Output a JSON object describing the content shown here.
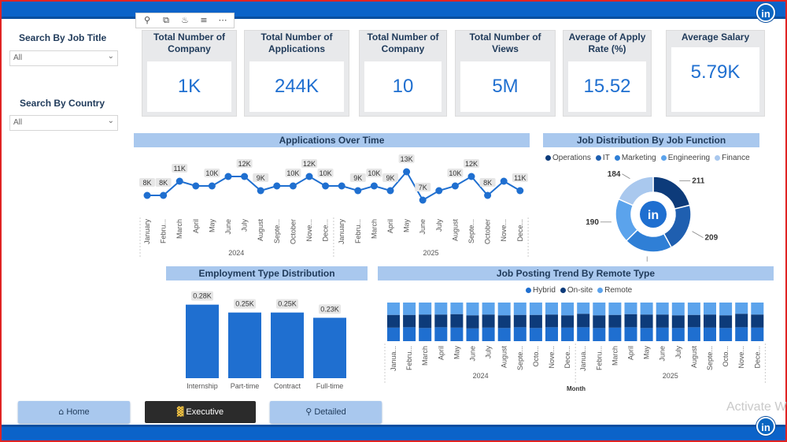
{
  "toolbar": {
    "icons": [
      "pin-icon",
      "copy-icon",
      "bell-icon",
      "filter-icon",
      "more-icon"
    ]
  },
  "brand": {
    "logo_text": "in"
  },
  "slicers": {
    "job_title": {
      "label": "Search By Job Title",
      "value": "All"
    },
    "country": {
      "label": "Search By Country",
      "value": "All"
    }
  },
  "kpis": [
    {
      "title": "Total Number of Company",
      "value": "1K"
    },
    {
      "title": "Total Number of Applications",
      "value": "244K"
    },
    {
      "title": "Total Number of Company",
      "value": "10"
    },
    {
      "title": "Total Number of Views",
      "value": "5M"
    },
    {
      "title": "Average of Apply Rate (%)",
      "value": "15.52"
    },
    {
      "title": "Average Salary",
      "value": "5.79K"
    }
  ],
  "sections": {
    "applications": "Applications Over Time",
    "job_distribution": "Job Distribution By Job Function",
    "employment": "Employment Type Distribution",
    "remote": "Job Posting Trend By Remote Type"
  },
  "nav": {
    "home": "Home",
    "executive": "Executive",
    "detailed": "Detailed"
  },
  "watermark": "Activate W",
  "colors": {
    "primary": "#0b63c9",
    "dark_navy": "#0d3b7a",
    "mid_blue": "#1f6fd0",
    "light_blue": "#5ba3ec",
    "pale_blue": "#a9c8ee",
    "accent_frame": "#e02424"
  },
  "chart_data": [
    {
      "type": "line",
      "title": "Applications Over Time",
      "x": [
        "January",
        "Febru...",
        "March",
        "April",
        "May",
        "June",
        "July",
        "August",
        "Septe...",
        "October",
        "Nove...",
        "Dece...",
        "January",
        "Febru...",
        "March",
        "April",
        "May",
        "June",
        "July",
        "August",
        "Septe...",
        "October",
        "Nove...",
        "Dece..."
      ],
      "years": [
        "2024",
        "2025"
      ],
      "series": [
        {
          "values": [
            8,
            8,
            11,
            10,
            10,
            12,
            12,
            9,
            10,
            10,
            12,
            10,
            10,
            9,
            10,
            9,
            13,
            7,
            9,
            10,
            12,
            8,
            11,
            9
          ]
        }
      ],
      "data_labels": [
        "8K",
        "8K",
        "11K",
        "",
        "10K",
        "",
        "12K",
        "9K",
        "",
        "10K",
        "12K",
        "10K",
        "",
        "9K",
        "10K",
        "9K",
        "13K",
        "7K",
        "",
        "10K",
        "12K",
        "8K",
        "",
        "11K"
      ],
      "ylim": [
        5,
        15
      ]
    },
    {
      "type": "pie",
      "title": "Job Distribution By Job Function",
      "legend": [
        "Operations",
        "IT",
        "Marketing",
        "Engineering",
        "Finance"
      ],
      "values": [
        211,
        209,
        206,
        190,
        184
      ],
      "colors": [
        "#0d3b7a",
        "#1f5fb0",
        "#2f7fd6",
        "#5ba3ec",
        "#a9c8ee"
      ]
    },
    {
      "type": "bar",
      "title": "Employment Type Distribution",
      "categories": [
        "Internship",
        "Part-time",
        "Contract",
        "Full-time"
      ],
      "values": [
        0.28,
        0.25,
        0.25,
        0.23
      ],
      "data_labels": [
        "0.28K",
        "0.25K",
        "0.25K",
        "0.23K"
      ],
      "ylim": [
        0,
        0.3
      ]
    },
    {
      "type": "bar",
      "title": "Job Posting Trend By Remote Type",
      "legend": [
        "Hybrid",
        "On-site",
        "Remote"
      ],
      "xlabel": "Month",
      "years": [
        "2024",
        "2025"
      ],
      "categories": [
        "Janua...",
        "Febru...",
        "March",
        "April",
        "May",
        "June",
        "July",
        "August",
        "Septe...",
        "Octo...",
        "Nove...",
        "Dece...",
        "Janua...",
        "Febru...",
        "March",
        "April",
        "May",
        "June",
        "July",
        "August",
        "Septe...",
        "Octo...",
        "Nove...",
        "Dece..."
      ],
      "series": [
        {
          "name": "Hybrid",
          "values": [
            35,
            36,
            34,
            36,
            35,
            33,
            35,
            34,
            36,
            34,
            36,
            35,
            36,
            34,
            35,
            36,
            34,
            35,
            34,
            36,
            35,
            34,
            36,
            35
          ]
        },
        {
          "name": "On-site",
          "values": [
            33,
            32,
            35,
            33,
            35,
            34,
            34,
            33,
            32,
            34,
            33,
            32,
            35,
            33,
            33,
            34,
            35,
            34,
            33,
            32,
            34,
            33,
            35,
            34
          ]
        },
        {
          "name": "Remote",
          "values": [
            32,
            32,
            31,
            31,
            30,
            33,
            31,
            33,
            32,
            32,
            31,
            33,
            29,
            33,
            32,
            30,
            31,
            31,
            33,
            32,
            31,
            33,
            29,
            31
          ]
        }
      ],
      "colors": [
        "#1f6fd0",
        "#0d3b7a",
        "#5ba3ec"
      ]
    }
  ]
}
